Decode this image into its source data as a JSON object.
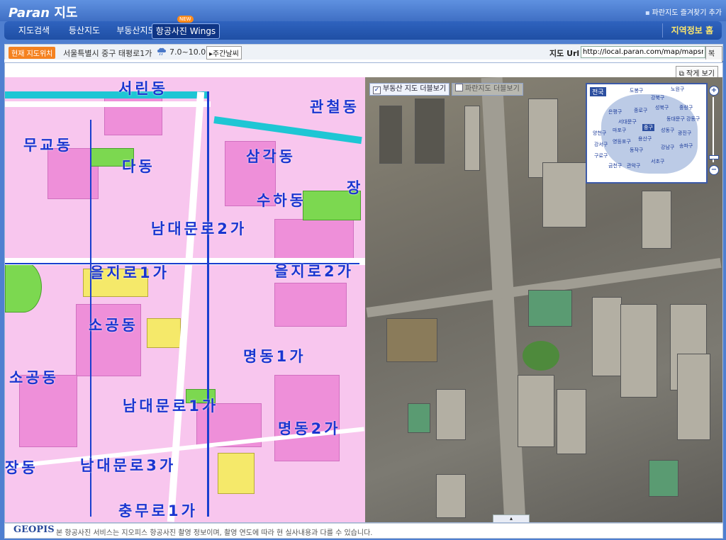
{
  "header": {
    "brand": "Paran",
    "title": "지도",
    "favorite_link": "파란지도 즐겨찾기 추가"
  },
  "nav": {
    "tabs": [
      {
        "label": "지도검색"
      },
      {
        "label": "등산지도"
      },
      {
        "label": "부동산지도"
      },
      {
        "label": "항공사진 Wings",
        "active": true,
        "badge": "NEW"
      }
    ],
    "region_home": "지역정보 홈"
  },
  "info": {
    "location_badge": "현재 지도위치",
    "address": "서울특별시 중구 태평로1가",
    "weather_icon": "weather-cloud-icon",
    "temperature": "7.0~10.0℃",
    "weekly_button": "주간날씨",
    "url_label": "지도 Url",
    "url_value": "http://local.paran.com/map/mapsrch_w",
    "copy_button": "복사"
  },
  "map": {
    "shrink_button": "작게 보기",
    "overlay_realestate": "부동산 지도 더블보기",
    "overlay_paran": "파란지도 더블보기",
    "minimap": {
      "title": "전국",
      "regions": [
        "은평구",
        "종로구",
        "성북구",
        "강북구",
        "중랑구",
        "서대문구",
        "동대문구",
        "마포구",
        "중구",
        "성동구",
        "광진구",
        "영등포구",
        "용산구",
        "강서구",
        "구로구",
        "동작구",
        "강남구",
        "송파구",
        "관악구",
        "서초구",
        "강동구",
        "노원구",
        "도봉구",
        "양천구",
        "금천구"
      ]
    },
    "district_labels": [
      "서린동",
      "관철동",
      "무교동",
      "다동",
      "삼각동",
      "수하동",
      "남대문로2가",
      "을지로1가",
      "을지로2가",
      "소공동",
      "명동1가",
      "소공동",
      "남대문로1가",
      "명동2가",
      "장동",
      "남대문로3가",
      "충무로1가",
      "장"
    ]
  },
  "footer": {
    "logo": "GEOPIS",
    "notice": "본 항공사진 서비스는 지오피스 항공사진 촬영 정보이며, 촬영 연도에 따라 현 실사내용과 다를 수 있습니다."
  }
}
